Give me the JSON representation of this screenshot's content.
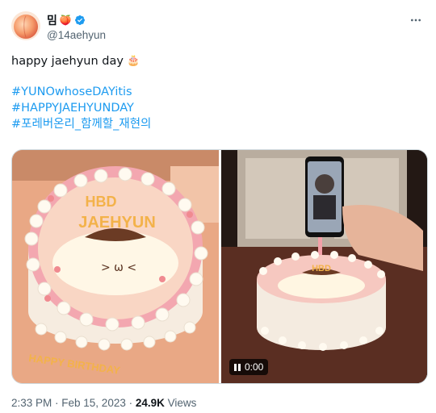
{
  "author": {
    "display_name": "밈",
    "name_emoji": "🍑",
    "handle": "@14aehyun",
    "avatar_icon": "peach-avatar-icon",
    "verified_color": "#1d9bf0"
  },
  "tweet": {
    "text": "happy jaehyun day",
    "emoji": "🎂",
    "hashtags": [
      "#YUNOwhoseDAYitis",
      "#HAPPYJAEHYUNDAY",
      "#포레버온리_함께할_재현의"
    ]
  },
  "media": {
    "left_image": "photo of decorated Pompompurin cake",
    "cake_text": [
      "HBD",
      "JAEHYUN"
    ],
    "board_text": "HAPPY BIRTHDAY",
    "video_time": "0:00"
  },
  "meta": {
    "time": "2:33 PM",
    "separator": " · ",
    "date": "Feb 15, 2023",
    "views_count": "24.9K",
    "views_label": "Views"
  },
  "colors": {
    "accent": "#1d9bf0",
    "text": "#0f1419",
    "secondary": "#536471"
  }
}
